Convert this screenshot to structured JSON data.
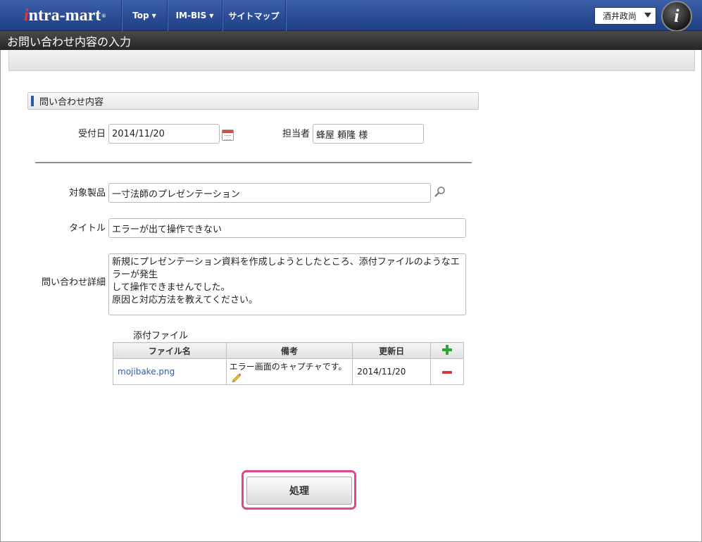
{
  "header": {
    "logo": {
      "mark": "i",
      "text": "ntra-mart",
      "registered": "®"
    },
    "nav": [
      {
        "label": "Top",
        "has_dropdown": true
      },
      {
        "label": "IM-BIS",
        "has_dropdown": true
      },
      {
        "label": "サイトマップ",
        "has_dropdown": false
      }
    ],
    "user": {
      "name": "酒井政尚"
    },
    "avatar_letter": "i"
  },
  "page": {
    "title": "お問い合わせ内容の入力"
  },
  "section": {
    "title": "問い合わせ内容"
  },
  "form": {
    "reception_date": {
      "label": "受付日",
      "value": "2014/11/20"
    },
    "assignee": {
      "label": "担当者",
      "value": "蜂屋 頼隆 様"
    },
    "product": {
      "label": "対象製品",
      "value": "一寸法師のプレゼンテーション"
    },
    "subject": {
      "label": "タイトル",
      "value": "エラーが出て操作できない"
    },
    "details": {
      "label": "問い合わせ詳細",
      "lines": [
        "新規にプレゼンテーション資料を作成しようとしたところ、添付ファイルのようなエラーが発生",
        "して操作できませんでした。",
        "原因と対応方法を教えてください。"
      ]
    }
  },
  "attachments": {
    "title": "添付ファイル",
    "columns": [
      "ファイル名",
      "備考",
      "更新日"
    ],
    "rows": [
      {
        "filename": "mojibake.png",
        "note": "エラー画面のキャプチャです。",
        "updated": "2014/11/20"
      }
    ]
  },
  "actions": {
    "submit_label": "処理"
  },
  "colors": {
    "nav_blue": "#2b4d96",
    "highlight_pink": "#e0448d",
    "link_blue": "#2a5db0"
  },
  "icons": [
    "calendar-icon",
    "search-icon",
    "pencil-icon",
    "plus-icon",
    "minus-icon",
    "chevron-down-icon"
  ]
}
